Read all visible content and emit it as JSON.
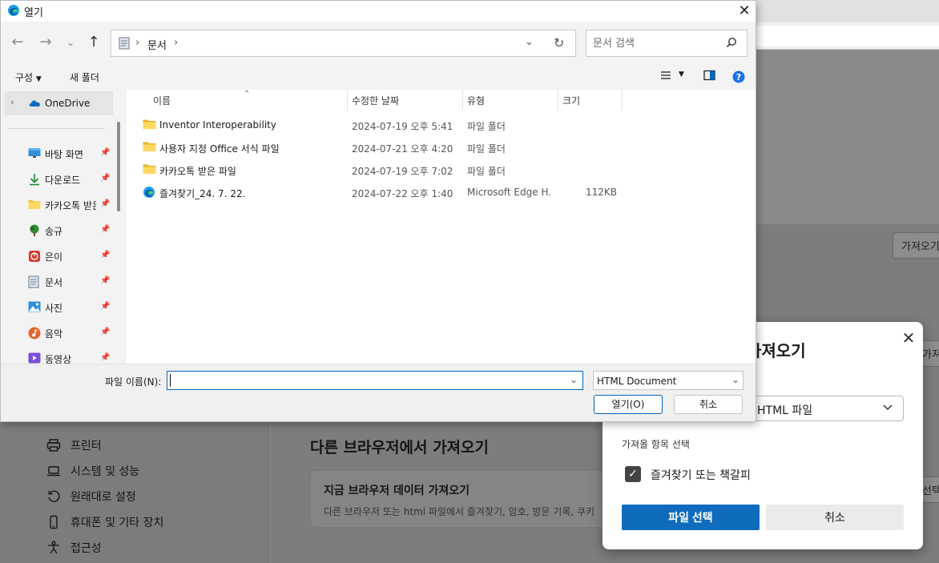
{
  "background": {
    "import_button_top": "가져오기",
    "import_button_mid": "가져오기",
    "select_button": "선택",
    "settings_nav": [
      {
        "icon": "printer-icon",
        "label": "프린터"
      },
      {
        "icon": "laptop-icon",
        "label": "시스템 및 성능"
      },
      {
        "icon": "reset-icon",
        "label": "원래대로 설정"
      },
      {
        "icon": "phone-icon",
        "label": "휴대폰 및 기타 장치"
      },
      {
        "icon": "accessibility-icon",
        "label": "접근성"
      }
    ],
    "section_title": "다른 브라우저에서 가져오기",
    "card_title": "지금 브라우저 데이터 가져오기",
    "card_desc": "다른 브라우저 또는 html 파일에서 즐겨찾기, 암호, 방문 기록, 쿠키"
  },
  "import_popup": {
    "title": "가져오기",
    "source_value": "HTML 파일",
    "items_label": "가져올 항목 선택",
    "checkbox_label": "즐겨찾기 또는 책갈피",
    "checkbox_checked": true,
    "primary_button": "파일 선택",
    "cancel_button": "취소"
  },
  "dialog": {
    "title": "열기",
    "path": [
      "문서"
    ],
    "search_placeholder": "문서 검색",
    "toolbar": {
      "organize": "구성",
      "new_folder": "새 폴더"
    },
    "nav": {
      "onedrive": "OneDrive",
      "quick_access": [
        {
          "icon": "desktop-icon",
          "label": "바탕 화면"
        },
        {
          "icon": "download-icon",
          "label": "다운로드"
        },
        {
          "icon": "folder-icon",
          "label": "카카오톡 받은 파일"
        },
        {
          "icon": "tree-icon",
          "label": "송규"
        },
        {
          "icon": "app-icon",
          "label": "은이"
        },
        {
          "icon": "document-icon",
          "label": "문서"
        },
        {
          "icon": "pictures-icon",
          "label": "사진"
        },
        {
          "icon": "music-icon",
          "label": "음악"
        },
        {
          "icon": "video-icon",
          "label": "동영상"
        }
      ]
    },
    "columns": {
      "name": "이름",
      "modified": "수정한 날짜",
      "type": "유형",
      "size": "크기"
    },
    "files": [
      {
        "icon": "folder-icon",
        "name": "Inventor Interoperability",
        "modified": "2024-07-19 오후 5:41",
        "type": "파일 폴더",
        "size": ""
      },
      {
        "icon": "folder-icon",
        "name": "사용자 지정 Office 서식 파일",
        "modified": "2024-07-21 오후 4:20",
        "type": "파일 폴더",
        "size": ""
      },
      {
        "icon": "folder-icon",
        "name": "카카오톡 받은 파일",
        "modified": "2024-07-19 오후 7:02",
        "type": "파일 폴더",
        "size": ""
      },
      {
        "icon": "edge-icon",
        "name": "즐겨찾기_24. 7. 22.",
        "modified": "2024-07-22 오후 1:40",
        "type": "Microsoft Edge H...",
        "size": "112KB"
      }
    ],
    "filename_label": "파일 이름(N):",
    "filename_value": "",
    "filetype_value": "HTML Document",
    "open_button": "열기(O)",
    "cancel_button": "취소"
  },
  "colors": {
    "accent": "#0f6cbd",
    "dialog_bg": "#f3f3f3",
    "folder": "#f4c542"
  }
}
